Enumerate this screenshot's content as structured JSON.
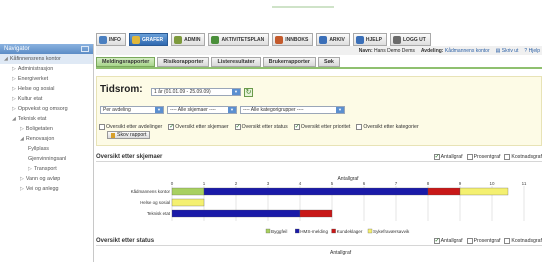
{
  "toolbar": {
    "items": [
      {
        "label": "INFO",
        "icon": "info-icon",
        "active": false,
        "color": "#4a7fc0"
      },
      {
        "label": "GRAFER",
        "icon": "chart-icon",
        "active": true,
        "color": "#e0b73a"
      },
      {
        "label": "ADMIN",
        "icon": "gear-icon",
        "active": false,
        "color": "#7d9a3c"
      },
      {
        "label": "AKTIVITETSPLAN",
        "icon": "calendar-icon",
        "active": false,
        "color": "#4a8f3a"
      },
      {
        "label": "INNBOKS",
        "icon": "inbox-icon",
        "active": false,
        "color": "#c45a2c"
      },
      {
        "label": "ARKIV",
        "icon": "archive-icon",
        "active": false,
        "color": "#3a6fb8"
      },
      {
        "label": "HJELP",
        "icon": "help-icon",
        "active": false,
        "color": "#3a6fb8"
      },
      {
        "label": "LOGG UT",
        "icon": "logout-icon",
        "active": false,
        "color": "#6b6b6b"
      }
    ]
  },
  "navigator": {
    "title": "Navigator",
    "items": [
      {
        "label": "Kåfinnensrens kontor",
        "indent": 0,
        "prefix": "◢",
        "selected": true
      },
      {
        "label": "Administrasjon",
        "indent": 1,
        "prefix": "▷",
        "selected": false
      },
      {
        "label": "Energiverket",
        "indent": 1,
        "prefix": "▷",
        "selected": false
      },
      {
        "label": "Helse og sosial",
        "indent": 1,
        "prefix": "▷",
        "selected": false
      },
      {
        "label": "Kultur etat",
        "indent": 1,
        "prefix": "▷",
        "selected": false
      },
      {
        "label": "Oppvekst og omsorg",
        "indent": 1,
        "prefix": "▷",
        "selected": false
      },
      {
        "label": "Teknisk etat",
        "indent": 1,
        "prefix": "◢",
        "selected": false
      },
      {
        "label": "Boligetaten",
        "indent": 2,
        "prefix": "▷",
        "selected": false
      },
      {
        "label": "Renovasjon",
        "indent": 2,
        "prefix": "◢",
        "selected": false
      },
      {
        "label": "Fyllplass",
        "indent": 3,
        "prefix": "",
        "selected": false
      },
      {
        "label": "Gjenvinningsanl",
        "indent": 3,
        "prefix": "",
        "selected": false
      },
      {
        "label": "Transport",
        "indent": 3,
        "prefix": "▷",
        "selected": false
      },
      {
        "label": "Vann og avløp",
        "indent": 2,
        "prefix": "▷",
        "selected": false
      },
      {
        "label": "Vei og anlegg",
        "indent": 2,
        "prefix": "▷",
        "selected": false
      }
    ]
  },
  "infobar": {
    "navn_label": "Navn:",
    "navn_value": "Hans Demo Dems",
    "avdeling_label": "Avdeling:",
    "avdeling_value": "Kådmannens kontor",
    "print_label": "Skriv ut",
    "help_label": "Hjelp"
  },
  "tabs": [
    {
      "label": "Meldingsrapporter",
      "active": true
    },
    {
      "label": "Risikorapporter",
      "active": false
    },
    {
      "label": "Listeresultater",
      "active": false
    },
    {
      "label": "Brukerrapporter",
      "active": false
    },
    {
      "label": "Søk",
      "active": false
    }
  ],
  "tidsrom": {
    "title": "Tidsrom:",
    "period_value": "1 år (01.01.09 - 25.09.09)",
    "filters": [
      "Per avdeling",
      "---- Alle skjemaer ----",
      "---- Alle kategorigrupper ----"
    ],
    "checkboxes": [
      {
        "label": "Oversikt etter avdelinger",
        "checked": false
      },
      {
        "label": "Oversikt etter skjemaer",
        "checked": true
      },
      {
        "label": "Oversikt etter status",
        "checked": true
      },
      {
        "label": "Oversikt etter prioritet",
        "checked": true
      },
      {
        "label": "Oversikt etter kategorier",
        "checked": false
      }
    ],
    "show_report_label": "Skov rapport"
  },
  "section1": {
    "title": "Oversikt etter skjemaer",
    "options": [
      {
        "label": "Antallgraf",
        "checked": true
      },
      {
        "label": "Prosentgraf",
        "checked": false
      },
      {
        "label": "Kostnadsgraf",
        "checked": false
      }
    ]
  },
  "section2": {
    "title": "Oversikt etter status",
    "options": [
      {
        "label": "Antallgraf",
        "checked": true
      },
      {
        "label": "Prosentgraf",
        "checked": false
      },
      {
        "label": "Kostnadsgraf",
        "checked": false
      }
    ],
    "axis_title": "Antallgraf"
  },
  "chart_data": {
    "type": "bar",
    "orientation": "horizontal",
    "stacked": true,
    "title": "Antallgraf",
    "xlim": [
      0,
      11
    ],
    "xticks": [
      "0",
      "1",
      "2",
      "3",
      "4",
      "5",
      "6",
      "7",
      "8",
      "9",
      "10",
      "11"
    ],
    "categories": [
      "Kådmannens kontor",
      "Helse og sosial",
      "Teknisk etat"
    ],
    "series": [
      {
        "name": "Byggfeil",
        "color": "#a8d060",
        "values": [
          1,
          0,
          0
        ]
      },
      {
        "name": "HMS-melding",
        "color": "#1a1aa8",
        "values": [
          7,
          0,
          4
        ]
      },
      {
        "name": "Kundeklager",
        "color": "#c81818",
        "values": [
          1,
          0,
          1
        ]
      },
      {
        "name": "Sykefraværsavvik",
        "color": "#f4f070",
        "values": [
          1.5,
          1,
          0
        ]
      }
    ],
    "grid": true,
    "legend": "bottom"
  }
}
